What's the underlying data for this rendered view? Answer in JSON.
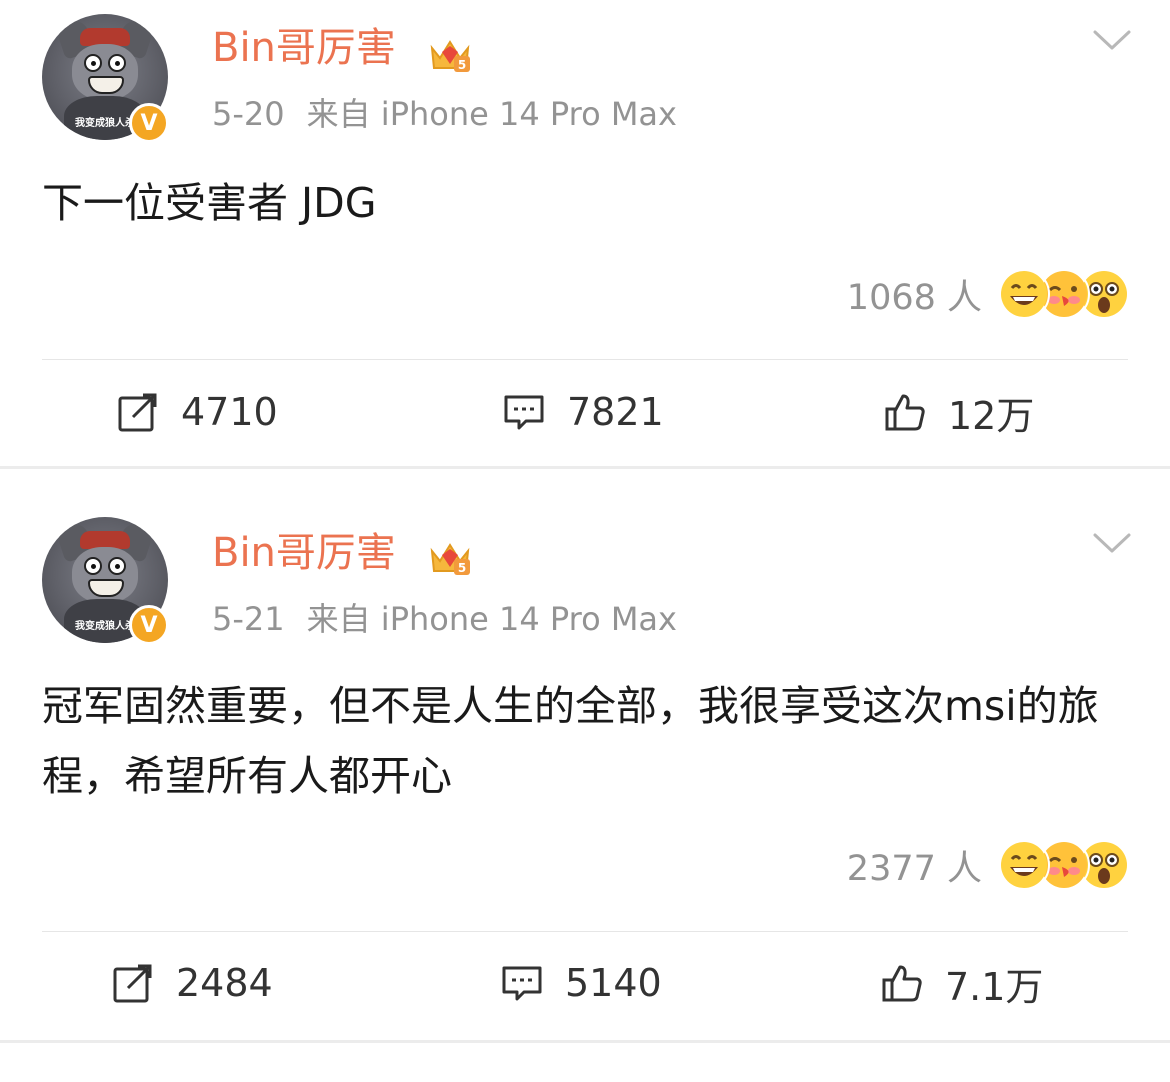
{
  "posts": [
    {
      "username": "Bin哥厉害",
      "avatar_caption": "我变成狼人杀",
      "verified_badge": "V",
      "date": "5-20",
      "source": "来自 iPhone 14 Pro Max",
      "content": "下一位受害者 JDG",
      "reaction_count": "1068 人",
      "actions": {
        "repost": "4710",
        "comment": "7821",
        "like": "12万"
      }
    },
    {
      "username": "Bin哥厉害",
      "avatar_caption": "我变成狼人杀",
      "verified_badge": "V",
      "date": "5-21",
      "source": "来自 iPhone 14 Pro Max",
      "content": "冠军固然重要，但不是人生的全部，我很享受这次msi的旅程，希望所有人都开心",
      "reaction_count": "2377 人",
      "actions": {
        "repost": "2484",
        "comment": "5140",
        "like": "7.1万"
      }
    }
  ],
  "icons": {
    "crown": "crown-level-5-icon",
    "more": "chevron-down-icon",
    "repost": "repost-icon",
    "comment": "comment-icon",
    "like": "thumbs-up-icon",
    "reactions": [
      "laughing-emoji-icon",
      "kissing-emoji-icon",
      "shocked-emoji-icon"
    ]
  },
  "colors": {
    "username": "#eb7350",
    "meta": "#939393",
    "verified": "#f4a623",
    "separator": "#ececec"
  }
}
